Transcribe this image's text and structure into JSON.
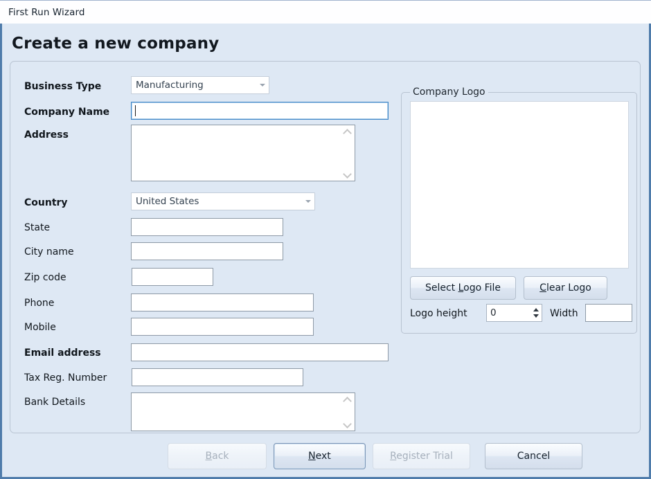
{
  "window": {
    "title": "First Run Wizard",
    "heading": "Create a new company",
    "accent_color": "#4f7cab",
    "background_color": "#dee8f4"
  },
  "form": {
    "fields": [
      {
        "label": "Business Type",
        "type": "combobox",
        "value": "Manufacturing",
        "bold": true
      },
      {
        "label": "Company Name",
        "type": "textbox",
        "value": "",
        "bold": true,
        "focused": true
      },
      {
        "label": "Address",
        "type": "textarea",
        "value": "",
        "bold": true
      },
      {
        "label": "Country",
        "type": "combobox",
        "value": "United States",
        "bold": true
      },
      {
        "label": "State",
        "type": "textbox",
        "value": "",
        "bold": false
      },
      {
        "label": "City name",
        "type": "textbox",
        "value": "",
        "bold": false
      },
      {
        "label": "Zip code",
        "type": "textbox",
        "value": "",
        "bold": false
      },
      {
        "label": "Phone",
        "type": "textbox",
        "value": "",
        "bold": false
      },
      {
        "label": "Mobile",
        "type": "textbox",
        "value": "",
        "bold": false
      },
      {
        "label": "Email address",
        "type": "textbox",
        "value": "",
        "bold": true
      },
      {
        "label": "Tax Reg. Number",
        "type": "textbox",
        "value": "",
        "bold": false
      },
      {
        "label": "Bank Details",
        "type": "textarea",
        "value": "",
        "bold": false
      }
    ]
  },
  "logo_panel": {
    "legend": "Company Logo",
    "select_button": {
      "prefix": "Select ",
      "accel": "L",
      "suffix": "ogo File"
    },
    "clear_button": {
      "prefix": "",
      "accel": "C",
      "suffix": "lear Logo"
    },
    "height_label": "Logo height",
    "height_value": "0",
    "width_label": "Width",
    "width_value": ""
  },
  "footer": {
    "back": {
      "prefix": "",
      "accel": "B",
      "suffix": "ack",
      "disabled": true
    },
    "next": {
      "prefix": "",
      "accel": "N",
      "suffix": "ext",
      "disabled": false,
      "default": true
    },
    "register": {
      "prefix": "",
      "accel": "R",
      "suffix": "egister Trial",
      "disabled": true
    },
    "cancel": {
      "label": "Cancel",
      "disabled": false
    }
  }
}
